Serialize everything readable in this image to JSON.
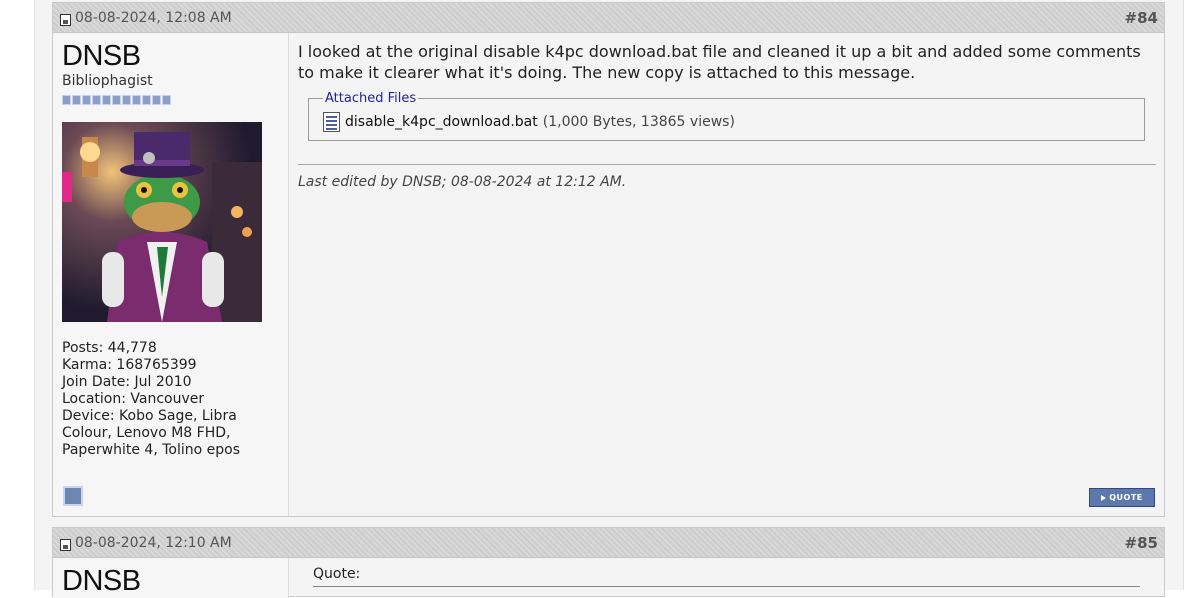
{
  "posts": [
    {
      "date": "08-08-2024, 12:08 AM",
      "number": "#84",
      "user": {
        "name": "DNSB",
        "title": "Bibliophagist",
        "stats": [
          "Posts: 44,778",
          "Karma: 168765399",
          "Join Date: Jul 2010",
          "Location: Vancouver",
          "Device: Kobo Sage, Libra Colour, Lenovo M8 FHD, Paperwhite 4, Tolino epos"
        ]
      },
      "message": "I looked at the original disable k4pc download.bat file and cleaned it up a bit and added some comments to make it clearer what it's doing. The new copy is attached to this message.",
      "attachments_legend": "Attached Files",
      "attachment": {
        "filename": "disable_k4pc_download.bat",
        "meta": "(1,000 Bytes, 13865 views)"
      },
      "edited": "Last edited by DNSB; 08-08-2024 at 12:12 AM.",
      "quote_button": "QUOTE"
    },
    {
      "date": "08-08-2024, 12:10 AM",
      "number": "#85",
      "user": {
        "name": "DNSB"
      },
      "quote_label": "Quote:"
    }
  ]
}
